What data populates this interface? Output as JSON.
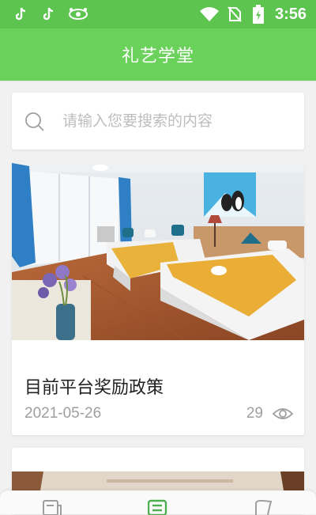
{
  "status_bar": {
    "time": "3:56",
    "icons": [
      "tiktok-icon",
      "tiktok-icon",
      "notification-icon",
      "wifi-icon",
      "no-sim-icon",
      "battery-icon"
    ]
  },
  "app_bar": {
    "title": "礼艺学堂"
  },
  "search": {
    "placeholder": "请输入您要搜索的内容",
    "icon": "search-icon"
  },
  "articles": [
    {
      "title": "目前平台奖励政策",
      "date": "2021-05-26",
      "views": "29",
      "image": "hotel-room-photo"
    },
    {
      "title": "",
      "image": "room-photo"
    }
  ],
  "bottom_nav": {
    "items": [
      {
        "icon": "news-icon",
        "active": false
      },
      {
        "icon": "list-icon",
        "active": true
      },
      {
        "icon": "profile-icon",
        "active": false
      }
    ]
  },
  "colors": {
    "primary": "#6ad15a",
    "status_bar": "#5dc44f",
    "muted_text": "#9e9e9e"
  }
}
